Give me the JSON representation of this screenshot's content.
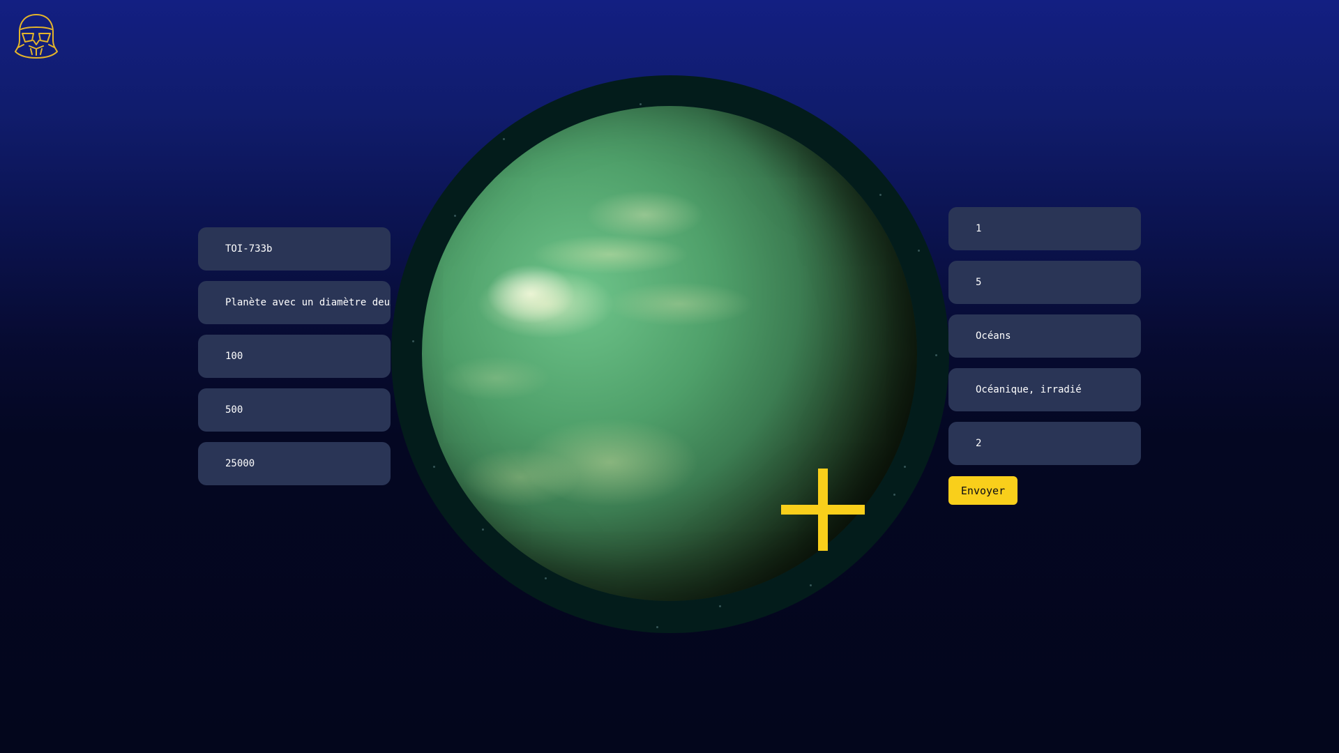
{
  "brand": {
    "logo_icon": "stormtrooper-helmet-icon",
    "logo_color": "#e5b52a"
  },
  "left_fields": [
    {
      "value": "TOI-733b"
    },
    {
      "value": "Planète avec un diamètre deux"
    },
    {
      "value": "100"
    },
    {
      "value": "500"
    },
    {
      "value": "25000"
    }
  ],
  "right_fields": [
    {
      "value": "1"
    },
    {
      "value": "5"
    },
    {
      "value": "Océans"
    },
    {
      "value": "Océanique, irradié"
    },
    {
      "value": "2"
    }
  ],
  "submit_label": "Envoyer",
  "colors": {
    "accent": "#f9cf1b",
    "field_bg": "#2a3556",
    "background_top": "#131f82",
    "background_bottom": "#03061c"
  },
  "icons": {
    "crosshair": "plus-crosshair-icon"
  }
}
